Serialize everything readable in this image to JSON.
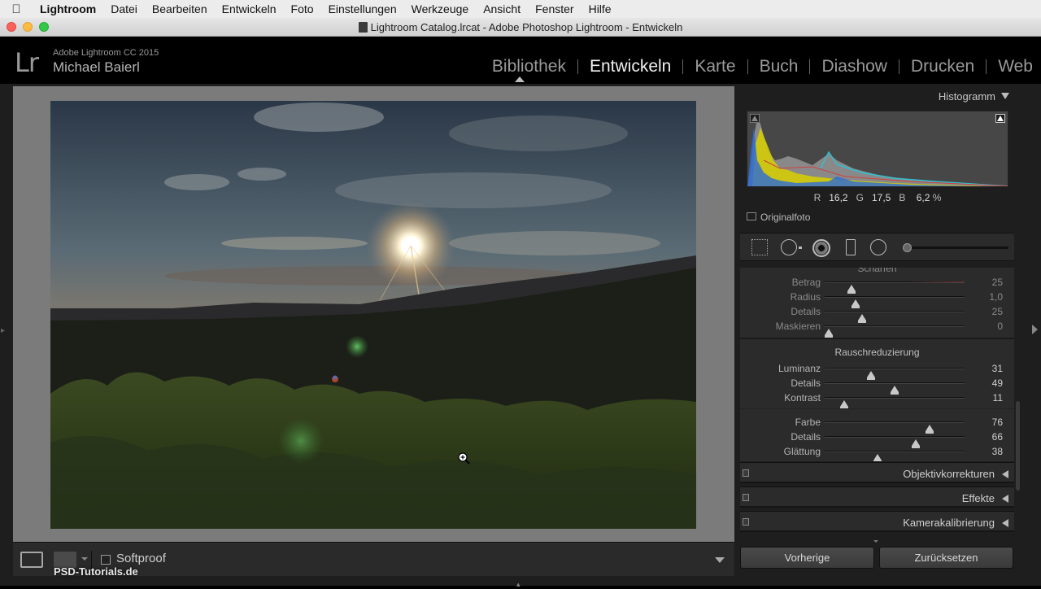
{
  "menubar": {
    "items": [
      "Lightroom",
      "Datei",
      "Bearbeiten",
      "Entwickeln",
      "Foto",
      "Einstellungen",
      "Werkzeuge",
      "Ansicht",
      "Fenster",
      "Hilfe"
    ]
  },
  "window": {
    "title": "Lightroom Catalog.lrcat - Adobe Photoshop Lightroom - Entwickeln"
  },
  "identity": {
    "logo": "Lr",
    "product": "Adobe Lightroom CC 2015",
    "user": "Michael Baierl"
  },
  "modules": [
    "Bibliothek",
    "Entwickeln",
    "Karte",
    "Buch",
    "Diashow",
    "Drucken",
    "Web"
  ],
  "active_module": "Entwickeln",
  "toolbar": {
    "softproof_label": "Softproof",
    "softproof_checked": false,
    "watermark": "PSD-Tutorials.de"
  },
  "histogram": {
    "title": "Histogramm",
    "r_label": "R",
    "r_value": "16,2",
    "g_label": "G",
    "g_value": "17,5",
    "b_label": "B",
    "b_value": "6,2",
    "unit": "%",
    "original_label": "Originalfoto"
  },
  "sharpening": {
    "title": "Schärfen",
    "rows": [
      {
        "label": "Betrag",
        "value": "25",
        "pos": 0.19
      },
      {
        "label": "Radius",
        "value": "1,0",
        "pos": 0.22
      },
      {
        "label": "Details",
        "value": "25",
        "pos": 0.27
      },
      {
        "label": "Maskieren",
        "value": "0",
        "pos": 0.03
      }
    ]
  },
  "noise": {
    "title": "Rauschreduzierung",
    "luminance_rows": [
      {
        "label": "Luminanz",
        "value": "31",
        "pos": 0.33
      },
      {
        "label": "Details",
        "value": "49",
        "pos": 0.5
      },
      {
        "label": "Kontrast",
        "value": "11",
        "pos": 0.14
      }
    ],
    "color_rows": [
      {
        "label": "Farbe",
        "value": "76",
        "pos": 0.75
      },
      {
        "label": "Details",
        "value": "66",
        "pos": 0.65
      },
      {
        "label": "Glättung",
        "value": "38",
        "pos": 0.38
      }
    ]
  },
  "panels": [
    "Objektivkorrekturen",
    "Effekte",
    "Kamerakalibrierung"
  ],
  "buttons": {
    "previous": "Vorherige",
    "reset": "Zurücksetzen"
  },
  "colors": {
    "menubar_bg": "#ececec",
    "panel_bg": "#2b2b2b",
    "canvas_bg": "#7b7b7b"
  }
}
